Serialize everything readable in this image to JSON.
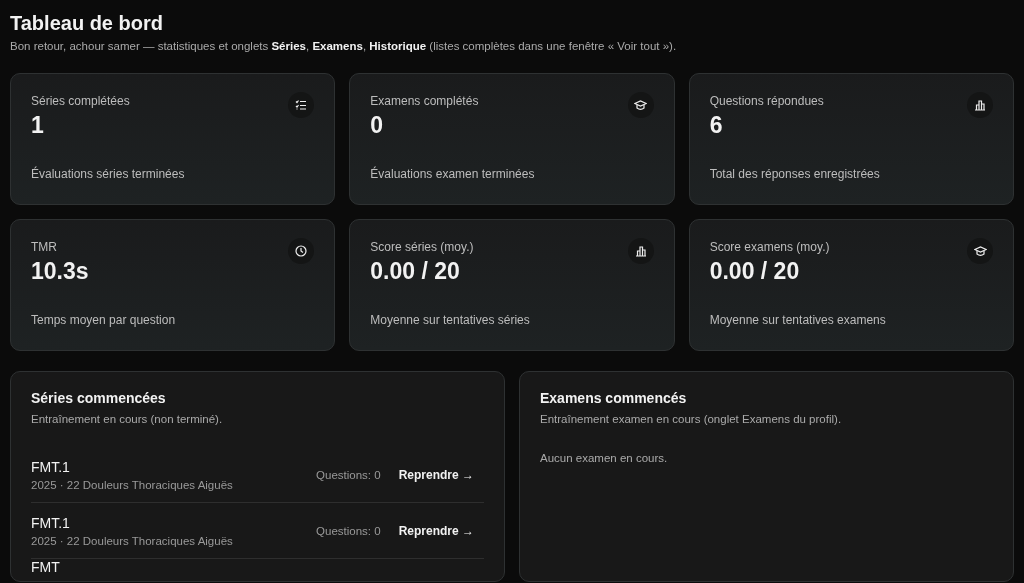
{
  "header": {
    "title": "Tableau de bord",
    "subtitle": "Bon retour, achour samer — statistiques et onglets **Séries**, **Examens**, **Historique** (listes complètes dans une fenêtre « Voir tout »)."
  },
  "stats": [
    {
      "label": "Séries complétées",
      "value": "1",
      "caption": "Évaluations séries terminées",
      "kind": "list"
    },
    {
      "label": "Examens complétés",
      "value": "0",
      "caption": "Évaluations examen terminées",
      "kind": "cap"
    },
    {
      "label": "Questions répondues",
      "value": "6",
      "caption": "Total des réponses enregistrées",
      "kind": "bars"
    },
    {
      "label": "TMR",
      "value": "10.3s",
      "caption": "Temps moyen par question",
      "kind": "clock"
    },
    {
      "label": "Score séries (moy.)",
      "value": "0.00 / 20",
      "caption": "Moyenne sur tentatives séries",
      "kind": "bars"
    },
    {
      "label": "Score examens (moy.)",
      "value": "0.00 / 20",
      "caption": "Moyenne sur tentatives examens",
      "kind": "cap"
    }
  ],
  "panels": [
    {
      "title": "Séries commencées",
      "description": "Entraînement en cours (non terminé).",
      "items": [
        {
          "name": "FMT.1",
          "detail": "2025 · 22 Douleurs Thoraciques Aiguës",
          "count": "Questions: 0",
          "action": "Reprendre →"
        },
        {
          "name": "FMT.1",
          "detail": "2025 · 22 Douleurs Thoraciques Aiguës",
          "count": "Questions: 0",
          "action": "Reprendre →"
        },
        {
          "name": "FMT"
        }
      ]
    },
    {
      "title": "Examens commencés",
      "description": "Entraînement examen en cours (onglet Examens du profil).",
      "empty": "Aucun examen en cours."
    }
  ]
}
